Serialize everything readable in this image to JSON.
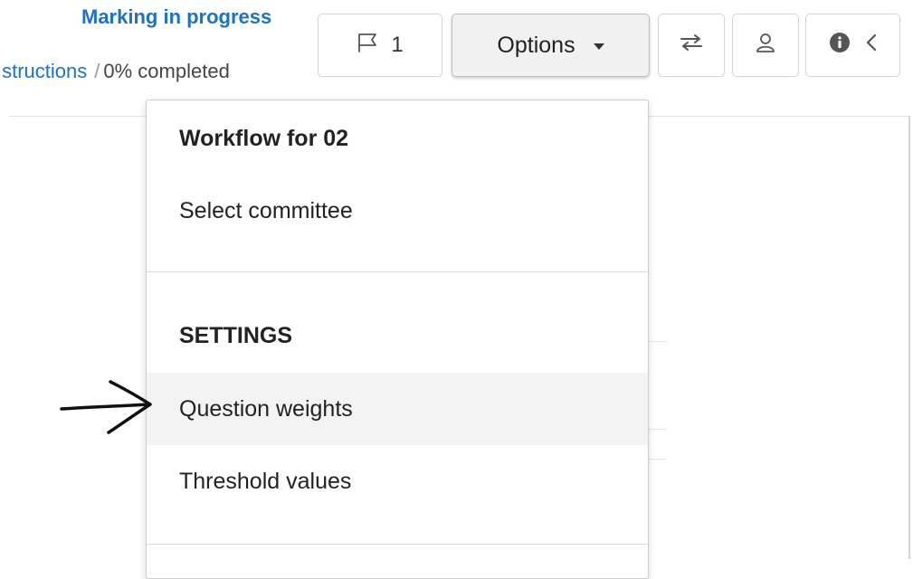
{
  "header": {
    "status": "Marking in progress",
    "breadcrumb": {
      "link": "ıstructions",
      "separator": "/",
      "status": "0% completed"
    }
  },
  "toolbar": {
    "flag_count": "1",
    "options_label": "Options"
  },
  "menu": {
    "workflow_heading": "Workflow for 02",
    "select_committee": "Select committee",
    "settings_heading": "SETTINGS",
    "question_weights": "Question weights",
    "threshold_values": "Threshold values"
  },
  "icons": {
    "flag": "flag-icon",
    "options_caret": "caret-down-icon",
    "swap": "swap-arrows-icon",
    "user": "user-icon",
    "info": "info-icon",
    "collapse": "chevron-left-icon",
    "annotation": "hand-drawn-arrow-icon"
  },
  "colors": {
    "link": "#1a73c4",
    "highlight": "#f3f3f3",
    "options_button": "#f1f1f1"
  }
}
